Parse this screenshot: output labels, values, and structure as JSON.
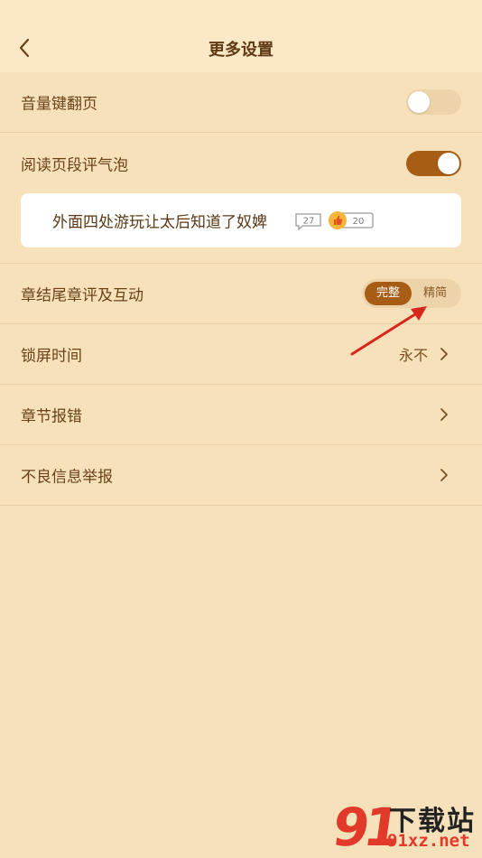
{
  "header": {
    "title": "更多设置"
  },
  "settings": {
    "volume_page_turn": {
      "label": "音量键翻页",
      "enabled": false
    },
    "paragraph_bubble": {
      "label": "阅读页段评气泡",
      "enabled": true,
      "preview_text": "外面四处游玩让太后知道了奴婢",
      "comment_count": "27",
      "like_count": "20"
    },
    "chapter_end": {
      "label": "章结尾章评及互动",
      "option_full": "完整",
      "option_simple": "精简",
      "selected": "完整"
    },
    "lock_screen": {
      "label": "锁屏时间",
      "value": "永不"
    },
    "report_error": {
      "label": "章节报错"
    },
    "report_bad": {
      "label": "不良信息举报"
    }
  },
  "watermark": {
    "number": "91",
    "text": "下载站",
    "url": "91xz.net"
  },
  "colors": {
    "background": "#f6e1bb",
    "header": "#fbe8c6",
    "accent": "#a85d14",
    "arrow": "#d9261c"
  }
}
